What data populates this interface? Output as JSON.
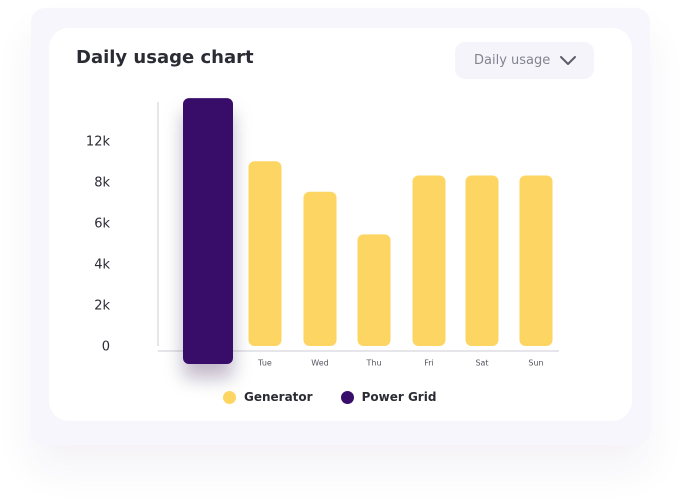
{
  "card": {
    "title": "Daily usage chart"
  },
  "dropdown": {
    "selected": "Daily usage",
    "icon": "chevron-down-icon"
  },
  "colors": {
    "generator": "#fdd563",
    "power_grid": "#390e6b",
    "axis": "#dedde3",
    "tick_text": "#2b2b34",
    "category_text": "#55555f"
  },
  "chart_data": {
    "type": "bar",
    "title": "Daily usage chart",
    "xlabel": "",
    "ylabel": "",
    "y_tick_labels": [
      "0",
      "2k",
      "4k",
      "6k",
      "8k",
      "12k"
    ],
    "ylim": [
      0,
      12000
    ],
    "grid": false,
    "legend_position": "bottom",
    "categories": [
      "",
      "Tue",
      "Wed",
      "Thu",
      "Fri",
      "Sat",
      "Sun"
    ],
    "bars": [
      {
        "category": "",
        "series": "Power Grid",
        "value": 13100
      },
      {
        "category": "Tue",
        "series": "Generator",
        "value": 9100
      },
      {
        "category": "Wed",
        "series": "Generator",
        "value": 7600
      },
      {
        "category": "Thu",
        "series": "Generator",
        "value": 5500
      },
      {
        "category": "Fri",
        "series": "Generator",
        "value": 8400
      },
      {
        "category": "Sat",
        "series": "Generator",
        "value": 8400
      },
      {
        "category": "Sun",
        "series": "Generator",
        "value": 8400
      }
    ],
    "series": [
      {
        "name": "Generator",
        "color": "#fdd563"
      },
      {
        "name": "Power Grid",
        "color": "#390e6b"
      }
    ]
  }
}
